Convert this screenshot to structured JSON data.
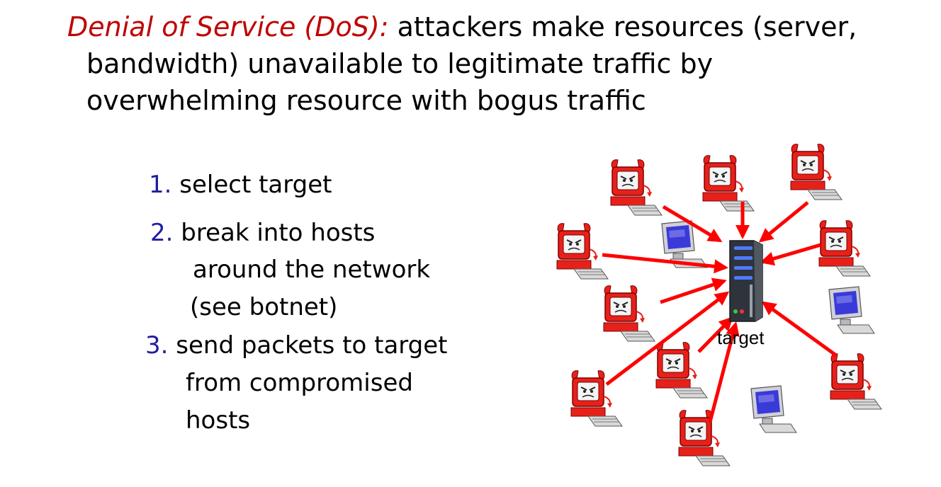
{
  "headline": {
    "term": "Denial of Service (DoS):",
    "line1_rest": " attackers make resources (server,",
    "line2": "bandwidth) unavailable to legitimate traffic by",
    "line3": "overwhelming resource with bogus traffic"
  },
  "steps": [
    {
      "number": "1.",
      "lines": [
        "select target"
      ]
    },
    {
      "number": "2.",
      "lines": [
        "break into hosts",
        "around the network",
        "(see botnet)"
      ]
    },
    {
      "number": "3.",
      "lines": [
        "send packets to target",
        "from compromised",
        "hosts"
      ]
    }
  ],
  "diagram": {
    "target_label": "target",
    "icons": {
      "server": "server-icon",
      "compromised_host": "devil-computer-icon",
      "clean_host": "computer-icon"
    },
    "colors": {
      "attack_arrow": "#ff0000",
      "devil": "#e8201a",
      "monitor_screen": "#3a3ad8",
      "server_body": "#333a44",
      "server_led": "#4f7bff"
    }
  }
}
